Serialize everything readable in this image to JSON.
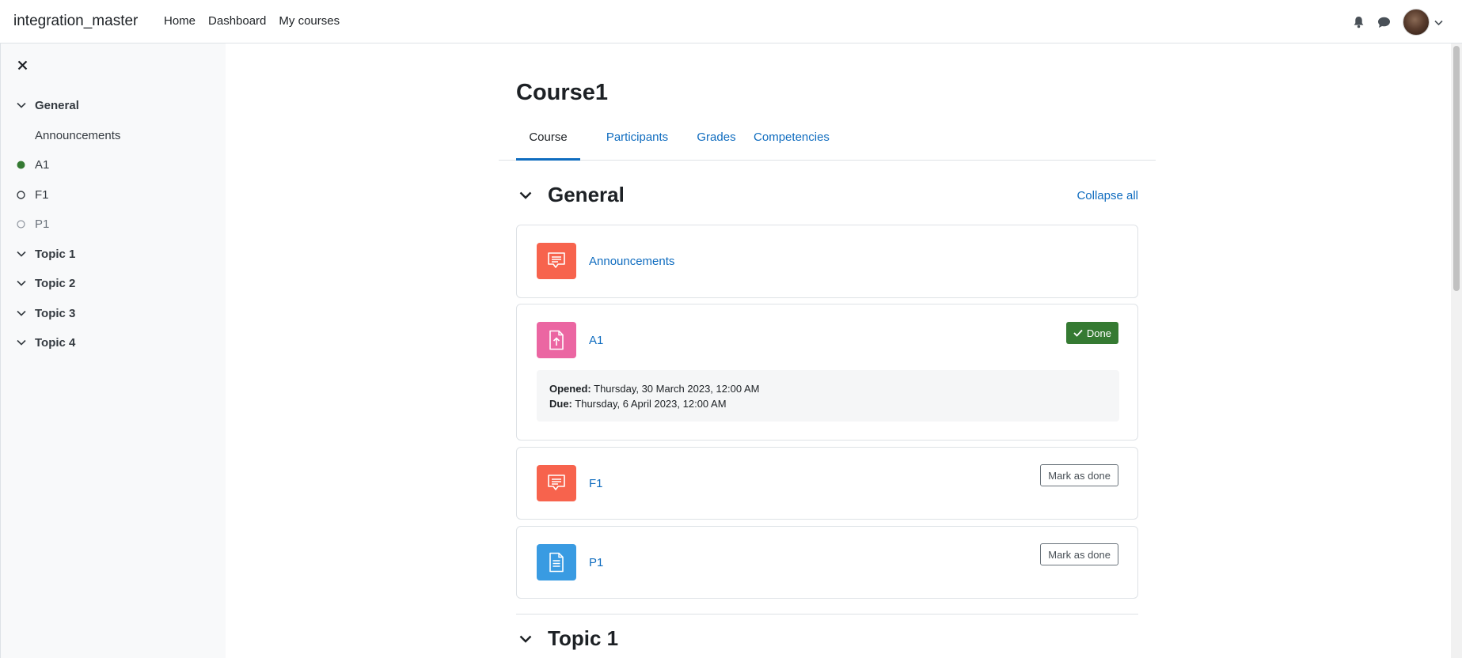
{
  "navbar": {
    "brand": "integration_master",
    "links": [
      "Home",
      "Dashboard",
      "My courses"
    ],
    "icons": [
      "bell-icon",
      "chat-icon",
      "avatar",
      "chevron-down-icon"
    ]
  },
  "drawer": {
    "close_icon": "close-icon",
    "items": [
      {
        "label": "General",
        "kind": "section"
      },
      {
        "label": "Announcements",
        "kind": "plain"
      },
      {
        "label": "A1",
        "kind": "complete"
      },
      {
        "label": "F1",
        "kind": "incomplete"
      },
      {
        "label": "P1",
        "kind": "incomplete-muted"
      },
      {
        "label": "Topic 1",
        "kind": "section"
      },
      {
        "label": "Topic 2",
        "kind": "section"
      },
      {
        "label": "Topic 3",
        "kind": "section"
      },
      {
        "label": "Topic 4",
        "kind": "section"
      }
    ]
  },
  "course": {
    "title": "Course1",
    "tabs": [
      "Course",
      "Participants",
      "Grades",
      "Competencies"
    ],
    "active_tab": "Course"
  },
  "sections": [
    {
      "title": "General",
      "collapse_all": "Collapse all",
      "activities": [
        {
          "name": "Announcements",
          "type": "forum",
          "color": "#f7634d"
        },
        {
          "name": "A1",
          "type": "assignment",
          "color": "#eb66a2",
          "completion": "Done",
          "opened_label": "Opened:",
          "opened_value": "Thursday, 30 March 2023, 12:00 AM",
          "due_label": "Due:",
          "due_value": "Thursday, 6 April 2023, 12:00 AM"
        },
        {
          "name": "F1",
          "type": "forum",
          "color": "#f7634d",
          "completion": "Mark as done"
        },
        {
          "name": "P1",
          "type": "page",
          "color": "#399be2",
          "completion": "Mark as done"
        }
      ]
    },
    {
      "title": "Topic 1"
    }
  ],
  "colors": {
    "link": "#0f6cbf",
    "done_green": "#357a32",
    "complete_dot": "#357a32"
  }
}
